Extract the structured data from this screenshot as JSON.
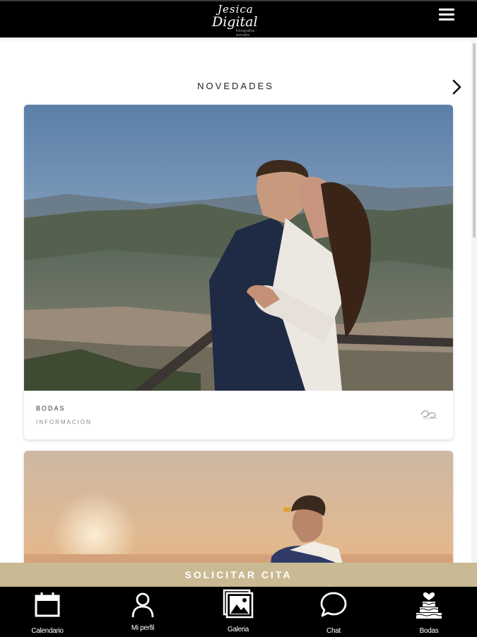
{
  "header": {
    "logo_line1": "Jesica",
    "logo_line2": "Digital",
    "logo_small": "fotografía · estudio",
    "logo_icon": "brand-logo",
    "menu_icon": "hamburger-icon"
  },
  "section": {
    "title": "NOVEDADES",
    "next_icon": "chevron-right-icon"
  },
  "cards": [
    {
      "title": "BODAS",
      "subtitle": "INFORMACIÓN"
    },
    {
      "title": "",
      "subtitle": ""
    }
  ],
  "cta": {
    "label": "SOLICITAR CITA"
  },
  "bottom_nav": [
    {
      "label": "Calendario",
      "icon": "calendar-icon"
    },
    {
      "label": "Mi perfil",
      "icon": "user-icon"
    },
    {
      "label": "Galeria",
      "icon": "gallery-icon"
    },
    {
      "label": "Chat",
      "icon": "chat-icon"
    },
    {
      "label": "Bodas",
      "icon": "wedding-cake-icon"
    }
  ],
  "colors": {
    "bar": "#000000",
    "cta": "#c9ba93",
    "text": "#222222"
  }
}
